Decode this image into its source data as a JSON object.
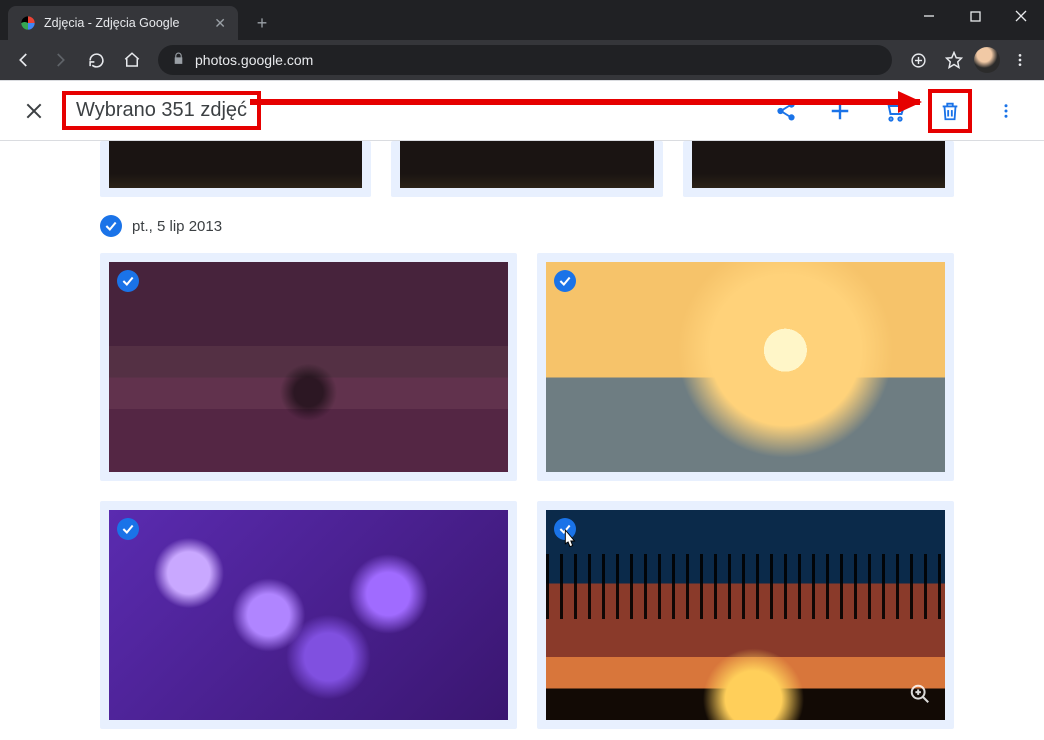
{
  "browser": {
    "tab_title": "Zdjęcia - Zdjęcia Google",
    "url": "photos.google.com"
  },
  "selection_bar": {
    "count_text": "Wybrano 351 zdjęć"
  },
  "sections": {
    "date_label": "pt., 5 lip 2013"
  },
  "icons": {
    "close_glyph": "✕",
    "plus_glyph": "+"
  }
}
